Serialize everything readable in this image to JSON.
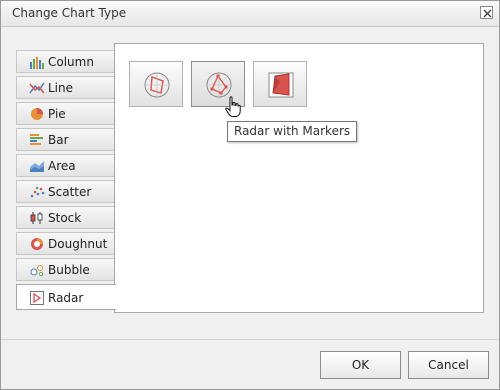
{
  "dialog": {
    "title": "Change Chart Type"
  },
  "tabs": [
    {
      "label": "Column",
      "icon": "column-chart-icon"
    },
    {
      "label": "Line",
      "icon": "line-chart-icon"
    },
    {
      "label": "Pie",
      "icon": "pie-chart-icon"
    },
    {
      "label": "Bar",
      "icon": "bar-chart-icon"
    },
    {
      "label": "Area",
      "icon": "area-chart-icon"
    },
    {
      "label": "Scatter",
      "icon": "scatter-chart-icon"
    },
    {
      "label": "Stock",
      "icon": "stock-chart-icon"
    },
    {
      "label": "Doughnut",
      "icon": "doughnut-chart-icon"
    },
    {
      "label": "Bubble",
      "icon": "bubble-chart-icon"
    },
    {
      "label": "Radar",
      "icon": "radar-chart-icon",
      "selected": true
    }
  ],
  "gallery": {
    "options": [
      {
        "icon": "radar-chart-icon"
      },
      {
        "icon": "radar-with-markers-icon",
        "hovered": true
      },
      {
        "icon": "filled-radar-icon"
      }
    ],
    "tooltip": "Radar with Markers"
  },
  "buttons": {
    "ok": "OK",
    "cancel": "Cancel"
  },
  "colors": {
    "accent": "#d9534f",
    "column_blue": "#4a7fc1",
    "column_green": "#6aa84f",
    "column_orange": "#e69138"
  }
}
